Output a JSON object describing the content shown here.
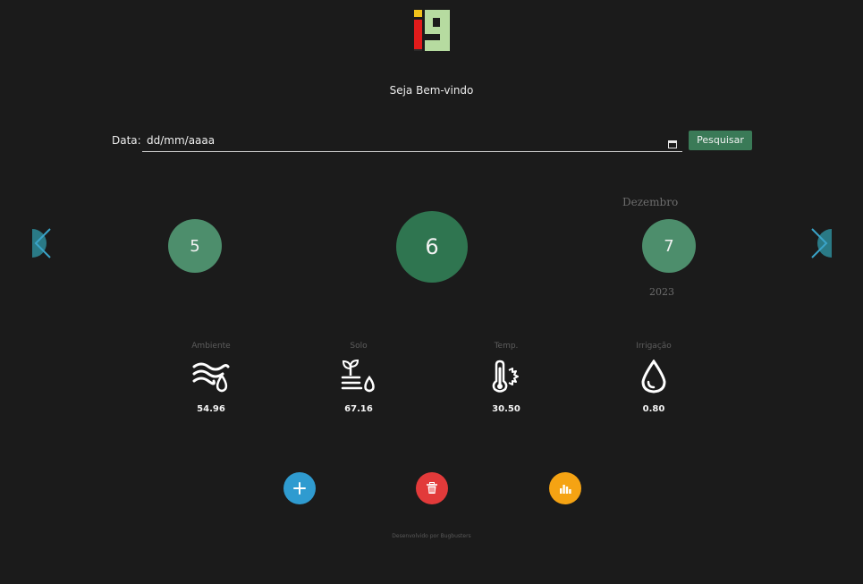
{
  "header": {
    "logo_text": "i9",
    "logo_icon": "i9-logo",
    "welcome": "Seja Bem-vindo"
  },
  "search": {
    "date_label": "Data:",
    "date_value": "dd/mm/aaaa",
    "calendar_icon": "calendar-icon",
    "button_label": "Pesquisar"
  },
  "carousel": {
    "month": "Dezembro",
    "year": "2023",
    "prev_day": "5",
    "current_day": "6",
    "next_day": "7",
    "prev_icon": "chevron-left-icon",
    "next_icon": "chevron-right-icon"
  },
  "metrics": [
    {
      "label": "Ambiente",
      "value": "54.96",
      "icon": "air-humidity-icon"
    },
    {
      "label": "Solo",
      "value": "67.16",
      "icon": "soil-moisture-icon"
    },
    {
      "label": "Temp.",
      "value": "30.50",
      "icon": "thermometer-icon"
    },
    {
      "label": "Irrigação",
      "value": "0.80",
      "icon": "water-drop-icon"
    }
  ],
  "actions": {
    "add_icon": "plus-icon",
    "delete_icon": "trash-icon",
    "chart_icon": "bar-chart-icon"
  },
  "footer": {
    "text": "Desenvolvido por Bugbusters"
  },
  "colors": {
    "background": "#1b1b1b",
    "day_circle": "#4d8e6c",
    "day_current": "#2f7550",
    "search_button": "#3a7a57",
    "add": "#2f9bd0",
    "delete": "#e23a3a",
    "chart": "#f5a313",
    "nav_arrow": "#3aa3c8"
  }
}
